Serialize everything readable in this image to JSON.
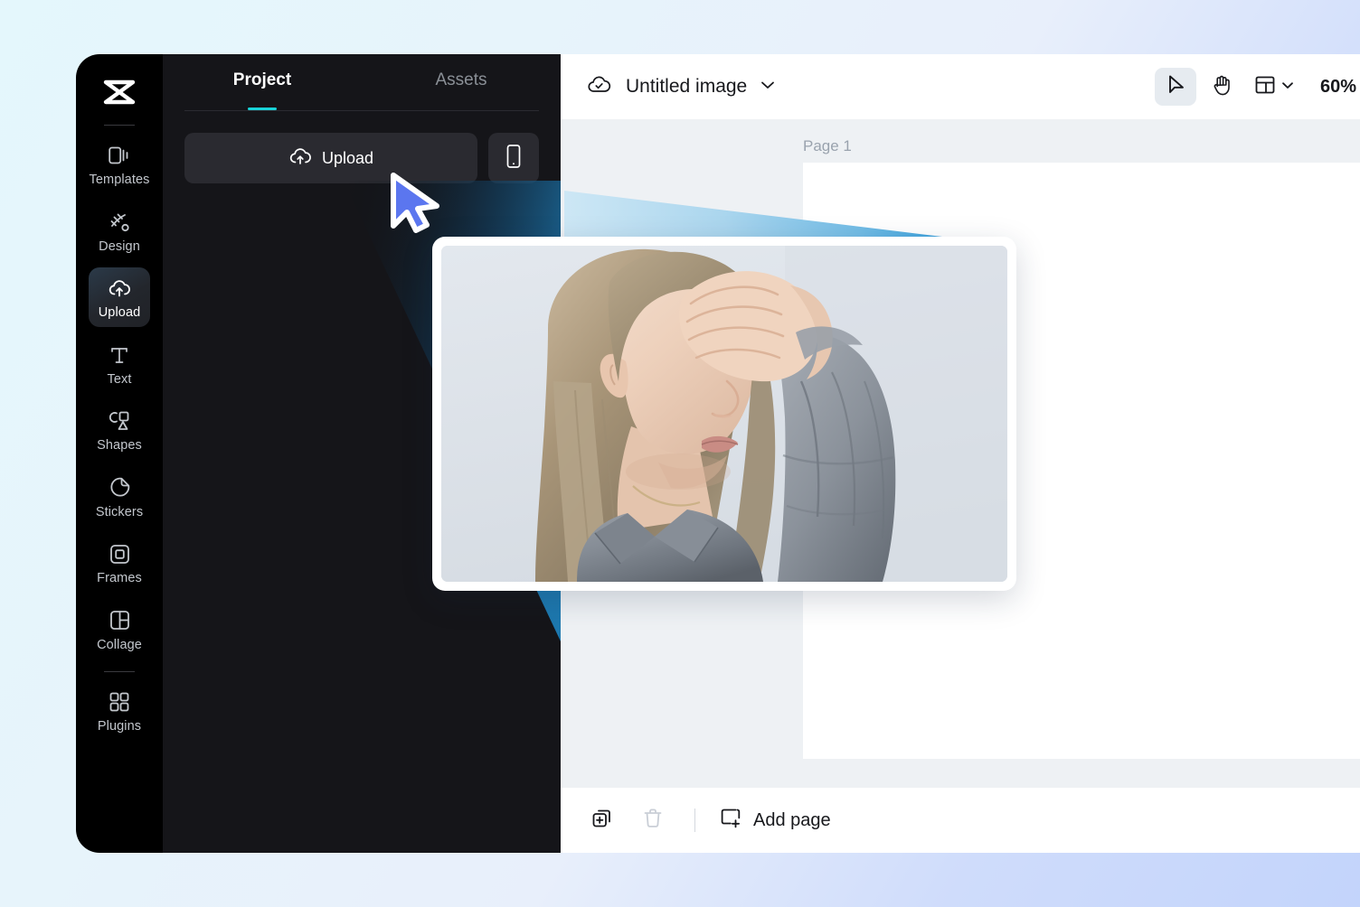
{
  "app": {
    "logo_icon": "capcut-logo-icon"
  },
  "rail": {
    "items": [
      {
        "label": "Templates",
        "icon": "templates-icon",
        "active": false
      },
      {
        "label": "Design",
        "icon": "design-icon",
        "active": false
      },
      {
        "label": "Upload",
        "icon": "upload-cloud-icon",
        "active": true
      },
      {
        "label": "Text",
        "icon": "text-icon",
        "active": false
      },
      {
        "label": "Shapes",
        "icon": "shapes-icon",
        "active": false
      },
      {
        "label": "Stickers",
        "icon": "stickers-icon",
        "active": false
      },
      {
        "label": "Frames",
        "icon": "frames-icon",
        "active": false
      },
      {
        "label": "Collage",
        "icon": "collage-icon",
        "active": false
      },
      {
        "label": "Plugins",
        "icon": "plugins-icon",
        "active": false
      }
    ]
  },
  "panel": {
    "tabs": [
      {
        "label": "Project",
        "active": true
      },
      {
        "label": "Assets",
        "active": false
      }
    ],
    "upload_label": "Upload",
    "upload_icon": "upload-cloud-icon",
    "device_icon": "mobile-phone-icon",
    "accent_color": "#19d3d8"
  },
  "topbar": {
    "cloud_icon": "cloud-saved-icon",
    "title": "Untitled image",
    "title_chevron_icon": "chevron-down-icon",
    "tools": [
      {
        "name": "select-tool",
        "icon": "cursor-arrow-icon",
        "active": true
      },
      {
        "name": "pan-tool",
        "icon": "hand-icon",
        "active": false
      }
    ],
    "layout_icon": "layout-panels-icon",
    "layout_chevron_icon": "chevron-down-icon",
    "zoom_level": "60%"
  },
  "canvas": {
    "page_label": "Page 1",
    "background_color": "#eef1f4",
    "sheet_color": "#ffffff"
  },
  "bottombar": {
    "duplicate_icon": "duplicate-page-icon",
    "delete_icon": "trash-icon",
    "add_page_icon": "add-page-icon",
    "add_page_label": "Add page"
  },
  "overlay": {
    "cursor_icon": "mouse-pointer-icon",
    "cursor_color": "#5b76ef",
    "beam_color_light": "#bfe0f2",
    "beam_color_strong": "#56b2e2",
    "card_image_alt": "woman-covering-face-photo"
  }
}
